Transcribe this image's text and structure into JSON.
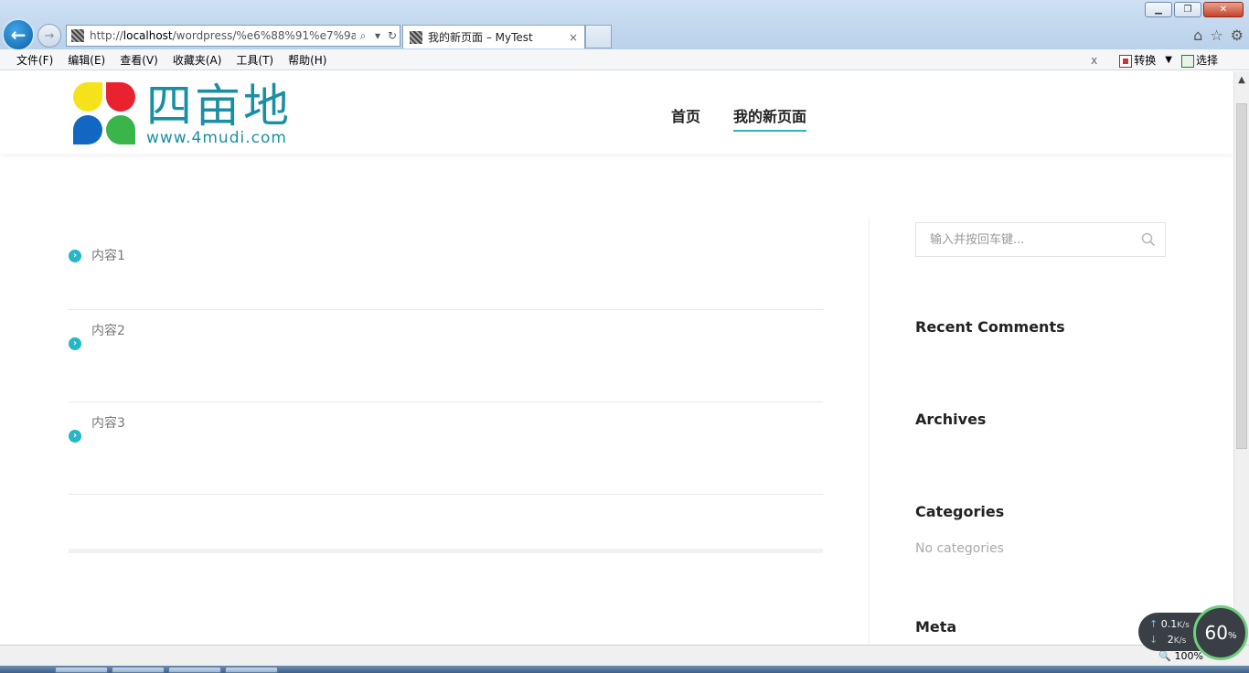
{
  "browser": {
    "address_url_prefix": "http://",
    "address_url_host": "localhost",
    "address_url_rest": "/wordpress/%e6%88%91%e7%9a",
    "tab_title": "我的新页面 – MyTest",
    "tab_close": "×",
    "menu": [
      "文件(F)",
      "编辑(E)",
      "查看(V)",
      "收藏夹(A)",
      "工具(T)",
      "帮助(H)"
    ],
    "toolbar_close": "x",
    "convert_label": "转换",
    "select_label": "选择",
    "zoom": "100%"
  },
  "site": {
    "logo_cn": "四亩地",
    "logo_url": "www.4mudi.com",
    "nav": [
      {
        "label": "首页",
        "active": false
      },
      {
        "label": "我的新页面",
        "active": true
      }
    ]
  },
  "content": {
    "items": [
      "内容1",
      "内容2",
      "内容3"
    ]
  },
  "sidebar": {
    "search_placeholder": "输入并按回车键...",
    "recent_comments": "Recent Comments",
    "archives": "Archives",
    "categories": "Categories",
    "categories_empty": "No categories",
    "meta": "Meta"
  },
  "speed": {
    "up": "0.1",
    "up_unit": "K/s",
    "down": "2",
    "down_unit": "K/s",
    "percent": "60",
    "percent_unit": "%"
  },
  "colors": {
    "accent": "#24b7c8",
    "logo": "#1a8fa3",
    "browser_back": "#0f5fa6"
  }
}
